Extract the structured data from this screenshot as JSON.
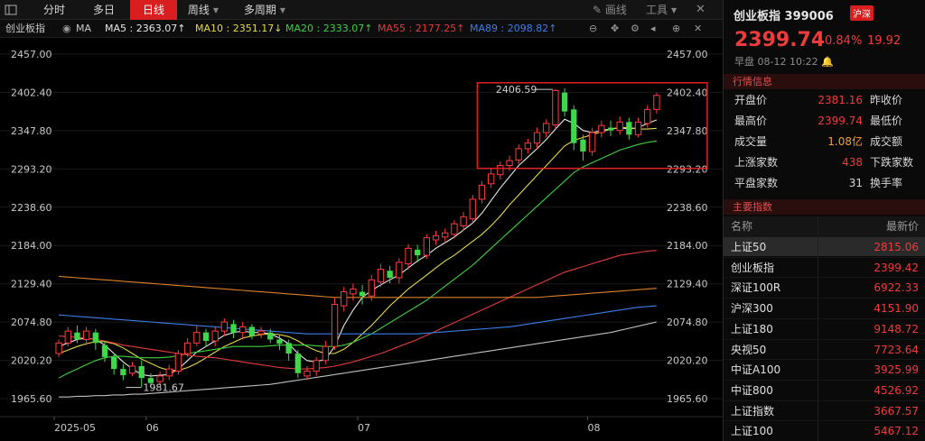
{
  "toolbar": {
    "tabs": [
      {
        "label": "分时",
        "active": false
      },
      {
        "label": "多日",
        "active": false
      },
      {
        "label": "日线",
        "active": true
      },
      {
        "label": "周线",
        "active": false,
        "dropdown": true
      },
      {
        "label": "多周期",
        "active": false,
        "dropdown": true
      }
    ],
    "draw_label": "画线",
    "tools_label": "工具"
  },
  "ma_bar": {
    "index_name": "创业板指",
    "ma_label": "MA",
    "items": [
      {
        "text": "MA5 : 2363.07↑",
        "color": "#e6e6e6"
      },
      {
        "text": "MA10 : 2351.17↓",
        "color": "#e6d84a"
      },
      {
        "text": "MA20 : 2333.07↑",
        "color": "#3ed03e"
      },
      {
        "text": "MA55 : 2177.25↑",
        "color": "#e03c3c"
      },
      {
        "text": "MA89 : 2098.82↑",
        "color": "#3c7de6"
      }
    ]
  },
  "chart_data": {
    "type": "candlestick",
    "y_ticks": [
      2457.0,
      2402.4,
      2347.8,
      2293.2,
      2238.6,
      2184.0,
      2129.4,
      2074.8,
      2020.2,
      1965.6
    ],
    "ylim": [
      1940,
      2480
    ],
    "x_ticks": [
      {
        "label": "2025-05",
        "i": 0
      },
      {
        "label": "06",
        "i": 10
      },
      {
        "label": "07",
        "i": 33
      },
      {
        "label": "08",
        "i": 58
      }
    ],
    "annotations": [
      {
        "text": "2406.59",
        "i": 54,
        "value": 2406.59,
        "side": "left"
      },
      {
        "text": "1981.67",
        "i": 7,
        "value": 1981.67,
        "side": "right"
      }
    ],
    "highlight_box": {
      "i_start": 46,
      "i_end": 70,
      "v_top": 2416,
      "v_bottom": 2294
    },
    "candles": [
      [
        2030,
        2045,
        2050,
        2025
      ],
      [
        2045,
        2062,
        2068,
        2040
      ],
      [
        2060,
        2050,
        2070,
        2045
      ],
      [
        2050,
        2062,
        2068,
        2042
      ],
      [
        2060,
        2045,
        2065,
        2035
      ],
      [
        2042,
        2025,
        2048,
        2018
      ],
      [
        2025,
        2008,
        2030,
        2000
      ],
      [
        2008,
        1999,
        2015,
        1992
      ],
      [
        2002,
        2012,
        2018,
        1998
      ],
      [
        2012,
        1995,
        2020,
        1982
      ],
      [
        1995,
        1988,
        2002,
        1982
      ],
      [
        1990,
        1998,
        2004,
        1985
      ],
      [
        1998,
        2008,
        2014,
        1992
      ],
      [
        2005,
        2030,
        2035,
        2000
      ],
      [
        2030,
        2045,
        2052,
        2025
      ],
      [
        2045,
        2060,
        2070,
        2040
      ],
      [
        2060,
        2048,
        2065,
        2040
      ],
      [
        2048,
        2062,
        2068,
        2040
      ],
      [
        2062,
        2075,
        2080,
        2055
      ],
      [
        2072,
        2060,
        2078,
        2052
      ],
      [
        2060,
        2068,
        2075,
        2050
      ],
      [
        2068,
        2055,
        2072,
        2050
      ],
      [
        2058,
        2062,
        2068,
        2052
      ],
      [
        2060,
        2050,
        2065,
        2045
      ],
      [
        2050,
        2044,
        2056,
        2035
      ],
      [
        2045,
        2030,
        2050,
        2020
      ],
      [
        2030,
        2002,
        2035,
        1995
      ],
      [
        1998,
        2005,
        2012,
        1992
      ],
      [
        2005,
        2020,
        2025,
        1998
      ],
      [
        2020,
        2040,
        2048,
        2015
      ],
      [
        2040,
        2100,
        2110,
        2035
      ],
      [
        2098,
        2118,
        2125,
        2090
      ],
      [
        2115,
        2122,
        2130,
        2105
      ],
      [
        2118,
        2112,
        2128,
        2100
      ],
      [
        2112,
        2135,
        2142,
        2105
      ],
      [
        2132,
        2150,
        2158,
        2125
      ],
      [
        2148,
        2138,
        2155,
        2130
      ],
      [
        2138,
        2160,
        2166,
        2130
      ],
      [
        2158,
        2180,
        2186,
        2150
      ],
      [
        2178,
        2170,
        2185,
        2160
      ],
      [
        2170,
        2195,
        2200,
        2165
      ],
      [
        2192,
        2198,
        2205,
        2185
      ],
      [
        2196,
        2202,
        2208,
        2190
      ],
      [
        2200,
        2215,
        2220,
        2194
      ],
      [
        2212,
        2225,
        2232,
        2205
      ],
      [
        2222,
        2250,
        2256,
        2216
      ],
      [
        2250,
        2270,
        2276,
        2244
      ],
      [
        2272,
        2286,
        2294,
        2266
      ],
      [
        2285,
        2298,
        2304,
        2278
      ],
      [
        2298,
        2305,
        2312,
        2290
      ],
      [
        2306,
        2322,
        2328,
        2300
      ],
      [
        2322,
        2330,
        2336,
        2315
      ],
      [
        2330,
        2345,
        2352,
        2322
      ],
      [
        2345,
        2358,
        2364,
        2338
      ],
      [
        2356,
        2405,
        2407,
        2350
      ],
      [
        2402,
        2375,
        2408,
        2368
      ],
      [
        2378,
        2330,
        2384,
        2320
      ],
      [
        2335,
        2318,
        2342,
        2305
      ],
      [
        2318,
        2345,
        2352,
        2312
      ],
      [
        2345,
        2355,
        2362,
        2338
      ],
      [
        2352,
        2348,
        2362,
        2340
      ],
      [
        2348,
        2360,
        2368,
        2342
      ],
      [
        2360,
        2342,
        2366,
        2335
      ],
      [
        2342,
        2360,
        2366,
        2338
      ],
      [
        2358,
        2378,
        2384,
        2352
      ],
      [
        2378,
        2398,
        2402,
        2372
      ]
    ],
    "ma_lines": [
      {
        "name": "MA5",
        "color": "#e6e6e6",
        "values": [
          2040,
          2045,
          2050,
          2052,
          2050,
          2042,
          2030,
          2018,
          2008,
          2000,
          1998,
          1999,
          2000,
          2008,
          2020,
          2032,
          2040,
          2048,
          2056,
          2060,
          2062,
          2060,
          2060,
          2058,
          2052,
          2044,
          2030,
          2020,
          2018,
          2022,
          2040,
          2070,
          2092,
          2110,
          2120,
          2128,
          2135,
          2142,
          2152,
          2162,
          2170,
          2180,
          2188,
          2196,
          2206,
          2216,
          2230,
          2248,
          2266,
          2282,
          2298,
          2310,
          2322,
          2335,
          2350,
          2364,
          2358,
          2348,
          2345,
          2348,
          2350,
          2352,
          2350,
          2352,
          2358,
          2363
        ]
      },
      {
        "name": "MA10",
        "color": "#e6d84a",
        "values": [
          2030,
          2035,
          2040,
          2044,
          2047,
          2047,
          2044,
          2038,
          2030,
          2022,
          2016,
          2010,
          2006,
          2006,
          2010,
          2016,
          2024,
          2032,
          2040,
          2046,
          2052,
          2055,
          2057,
          2058,
          2057,
          2054,
          2048,
          2040,
          2034,
          2030,
          2030,
          2036,
          2046,
          2058,
          2070,
          2084,
          2098,
          2110,
          2122,
          2132,
          2142,
          2152,
          2162,
          2170,
          2180,
          2190,
          2200,
          2212,
          2226,
          2242,
          2256,
          2270,
          2284,
          2298,
          2312,
          2326,
          2334,
          2338,
          2342,
          2346,
          2350,
          2352,
          2352,
          2350,
          2350,
          2351
        ]
      },
      {
        "name": "MA20",
        "color": "#3ed03e",
        "values": [
          1995,
          2002,
          2008,
          2014,
          2020,
          2024,
          2026,
          2026,
          2025,
          2024,
          2024,
          2024,
          2025,
          2027,
          2030,
          2032,
          2034,
          2036,
          2038,
          2040,
          2040,
          2040,
          2040,
          2041,
          2042,
          2042,
          2042,
          2042,
          2041,
          2040,
          2040,
          2042,
          2046,
          2052,
          2058,
          2066,
          2074,
          2082,
          2090,
          2098,
          2106,
          2116,
          2126,
          2136,
          2146,
          2156,
          2168,
          2180,
          2192,
          2204,
          2216,
          2228,
          2240,
          2252,
          2264,
          2276,
          2288,
          2296,
          2302,
          2308,
          2314,
          2320,
          2324,
          2328,
          2331,
          2333
        ]
      },
      {
        "name": "MA55",
        "color": "#e03c3c",
        "values": [
          2055,
          2054,
          2053,
          2052,
          2050,
          2048,
          2045,
          2042,
          2040,
          2038,
          2036,
          2034,
          2032,
          2030,
          2028,
          2026,
          2025,
          2024,
          2022,
          2020,
          2018,
          2016,
          2014,
          2012,
          2010,
          2009,
          2008,
          2008,
          2009,
          2010,
          2012,
          2015,
          2018,
          2022,
          2026,
          2030,
          2035,
          2040,
          2045,
          2050,
          2056,
          2062,
          2068,
          2074,
          2080,
          2086,
          2092,
          2098,
          2104,
          2110,
          2116,
          2122,
          2128,
          2134,
          2140,
          2146,
          2150,
          2154,
          2158,
          2162,
          2166,
          2170,
          2172,
          2174,
          2176,
          2177
        ]
      },
      {
        "name": "MA89",
        "color": "#3c7de6",
        "values": [
          2085,
          2084,
          2083,
          2082,
          2081,
          2080,
          2079,
          2078,
          2077,
          2076,
          2075,
          2074,
          2073,
          2072,
          2071,
          2070,
          2069,
          2068,
          2067,
          2066,
          2065,
          2064,
          2063,
          2062,
          2061,
          2060,
          2059,
          2058,
          2058,
          2058,
          2058,
          2058,
          2058,
          2058,
          2058,
          2058,
          2058,
          2058,
          2058,
          2058,
          2059,
          2060,
          2061,
          2062,
          2063,
          2064,
          2065,
          2066,
          2067,
          2068,
          2070,
          2072,
          2074,
          2076,
          2078,
          2080,
          2082,
          2084,
          2086,
          2088,
          2090,
          2092,
          2094,
          2096,
          2097,
          2098
        ]
      },
      {
        "name": "MA-orange",
        "color": "#d9822b",
        "values": [
          2140,
          2139,
          2138,
          2137,
          2136,
          2135,
          2134,
          2133,
          2132,
          2131,
          2130,
          2129,
          2128,
          2127,
          2126,
          2125,
          2124,
          2123,
          2122,
          2121,
          2120,
          2119,
          2118,
          2117,
          2116,
          2115,
          2114,
          2113,
          2112,
          2111,
          2110,
          2110,
          2110,
          2110,
          2110,
          2110,
          2110,
          2110,
          2110,
          2110,
          2110,
          2110,
          2110,
          2110,
          2110,
          2110,
          2110,
          2110,
          2110,
          2110,
          2110,
          2110,
          2110,
          2111,
          2112,
          2113,
          2114,
          2115,
          2116,
          2117,
          2118,
          2119,
          2120,
          2121,
          2122,
          2123
        ]
      },
      {
        "name": "MA-grey",
        "color": "#bfbfbf",
        "values": [
          1968,
          1968,
          1969,
          1969,
          1970,
          1970,
          1971,
          1971,
          1972,
          1972,
          1973,
          1974,
          1975,
          1976,
          1977,
          1978,
          1979,
          1980,
          1981,
          1982,
          1983,
          1984,
          1985,
          1986,
          1988,
          1990,
          1992,
          1994,
          1996,
          1998,
          2000,
          2002,
          2004,
          2006,
          2008,
          2010,
          2012,
          2014,
          2016,
          2018,
          2020,
          2022,
          2024,
          2026,
          2028,
          2030,
          2032,
          2034,
          2036,
          2038,
          2040,
          2042,
          2044,
          2046,
          2048,
          2050,
          2052,
          2054,
          2056,
          2058,
          2060,
          2063,
          2066,
          2069,
          2072,
          2075
        ]
      }
    ]
  },
  "panel": {
    "name": "创业板指 399006",
    "tag": "沪深",
    "price": "2399.74",
    "pct": "0.84%",
    "change": "19.92",
    "status": "早盘  08-12  10:22",
    "info_header": "行情信息",
    "info": [
      {
        "label": "开盘价",
        "value": "2381.16",
        "color": "red",
        "label2": "昨收价"
      },
      {
        "label": "最高价",
        "value": "2399.74",
        "color": "red",
        "label2": "最低价"
      },
      {
        "label": "成交量",
        "value": "1.08亿",
        "color": "orange",
        "label2": "成交额"
      },
      {
        "label": "上涨家数",
        "value": "438",
        "color": "red",
        "label2": "下跌家数"
      },
      {
        "label": "平盘家数",
        "value": "31",
        "color": "white",
        "label2": "换手率"
      }
    ],
    "index_header": "主要指数",
    "index_col_name": "名称",
    "index_col_price": "最新价",
    "indices": [
      {
        "name": "上证50",
        "price": "2815.06",
        "selected": true
      },
      {
        "name": "创业板指",
        "price": "2399.42"
      },
      {
        "name": "深证100R",
        "price": "6922.33"
      },
      {
        "name": "沪深300",
        "price": "4151.90"
      },
      {
        "name": "上证180",
        "price": "9148.72"
      },
      {
        "name": "央视50",
        "price": "7723.64"
      },
      {
        "name": "中证A100",
        "price": "3925.99"
      },
      {
        "name": "中证800",
        "price": "4526.92"
      },
      {
        "name": "上证指数",
        "price": "3667.57"
      },
      {
        "name": "上证100",
        "price": "5467.12"
      }
    ]
  }
}
